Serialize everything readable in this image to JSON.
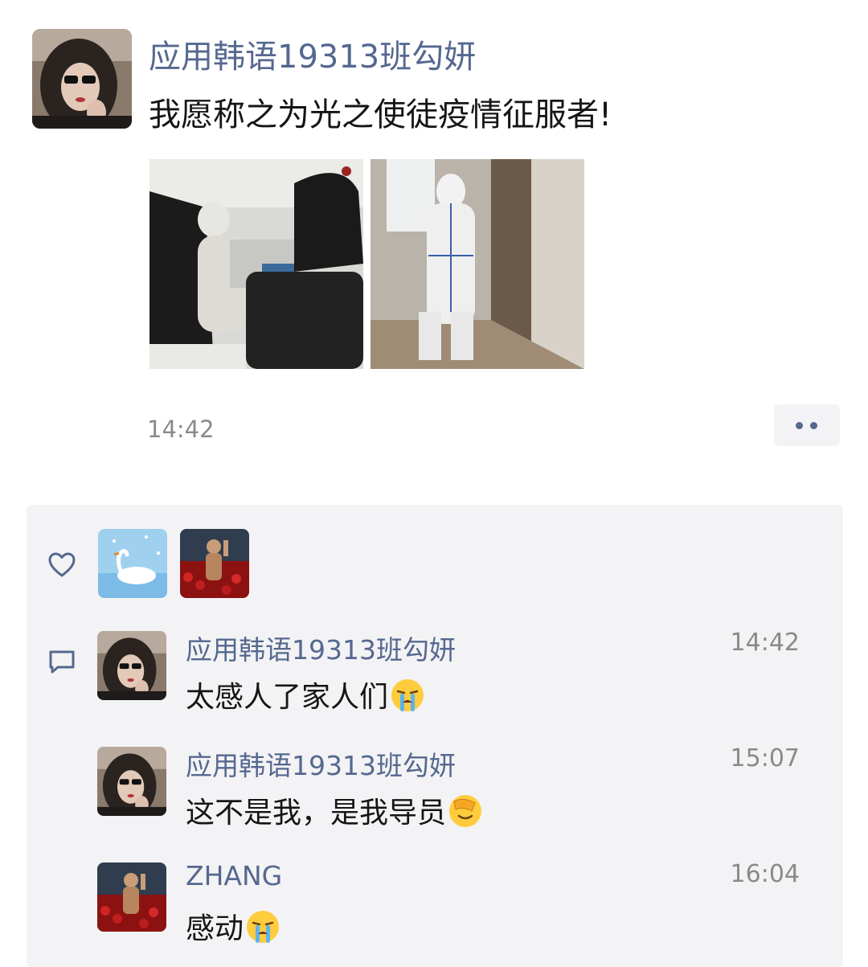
{
  "post": {
    "author": "应用韩语19313班勾妍",
    "text": "我愿称之为光之使徒疫情征服者!",
    "time": "14:42"
  },
  "comments": [
    {
      "author": "应用韩语19313班勾妍",
      "time": "14:42",
      "text": "太感人了家人们",
      "emoji": "crying-face-icon"
    },
    {
      "author": "应用韩语19313班勾妍",
      "time": "15:07",
      "text": "这不是我，是我导员",
      "emoji": "facepalm-icon"
    },
    {
      "author": "ZHANG",
      "time": "16:04",
      "text": "感动",
      "emoji": "crying-face-icon"
    }
  ],
  "colors": {
    "name": "#55688f",
    "panel": "#f3f3f5",
    "time": "#8a8a8a"
  }
}
